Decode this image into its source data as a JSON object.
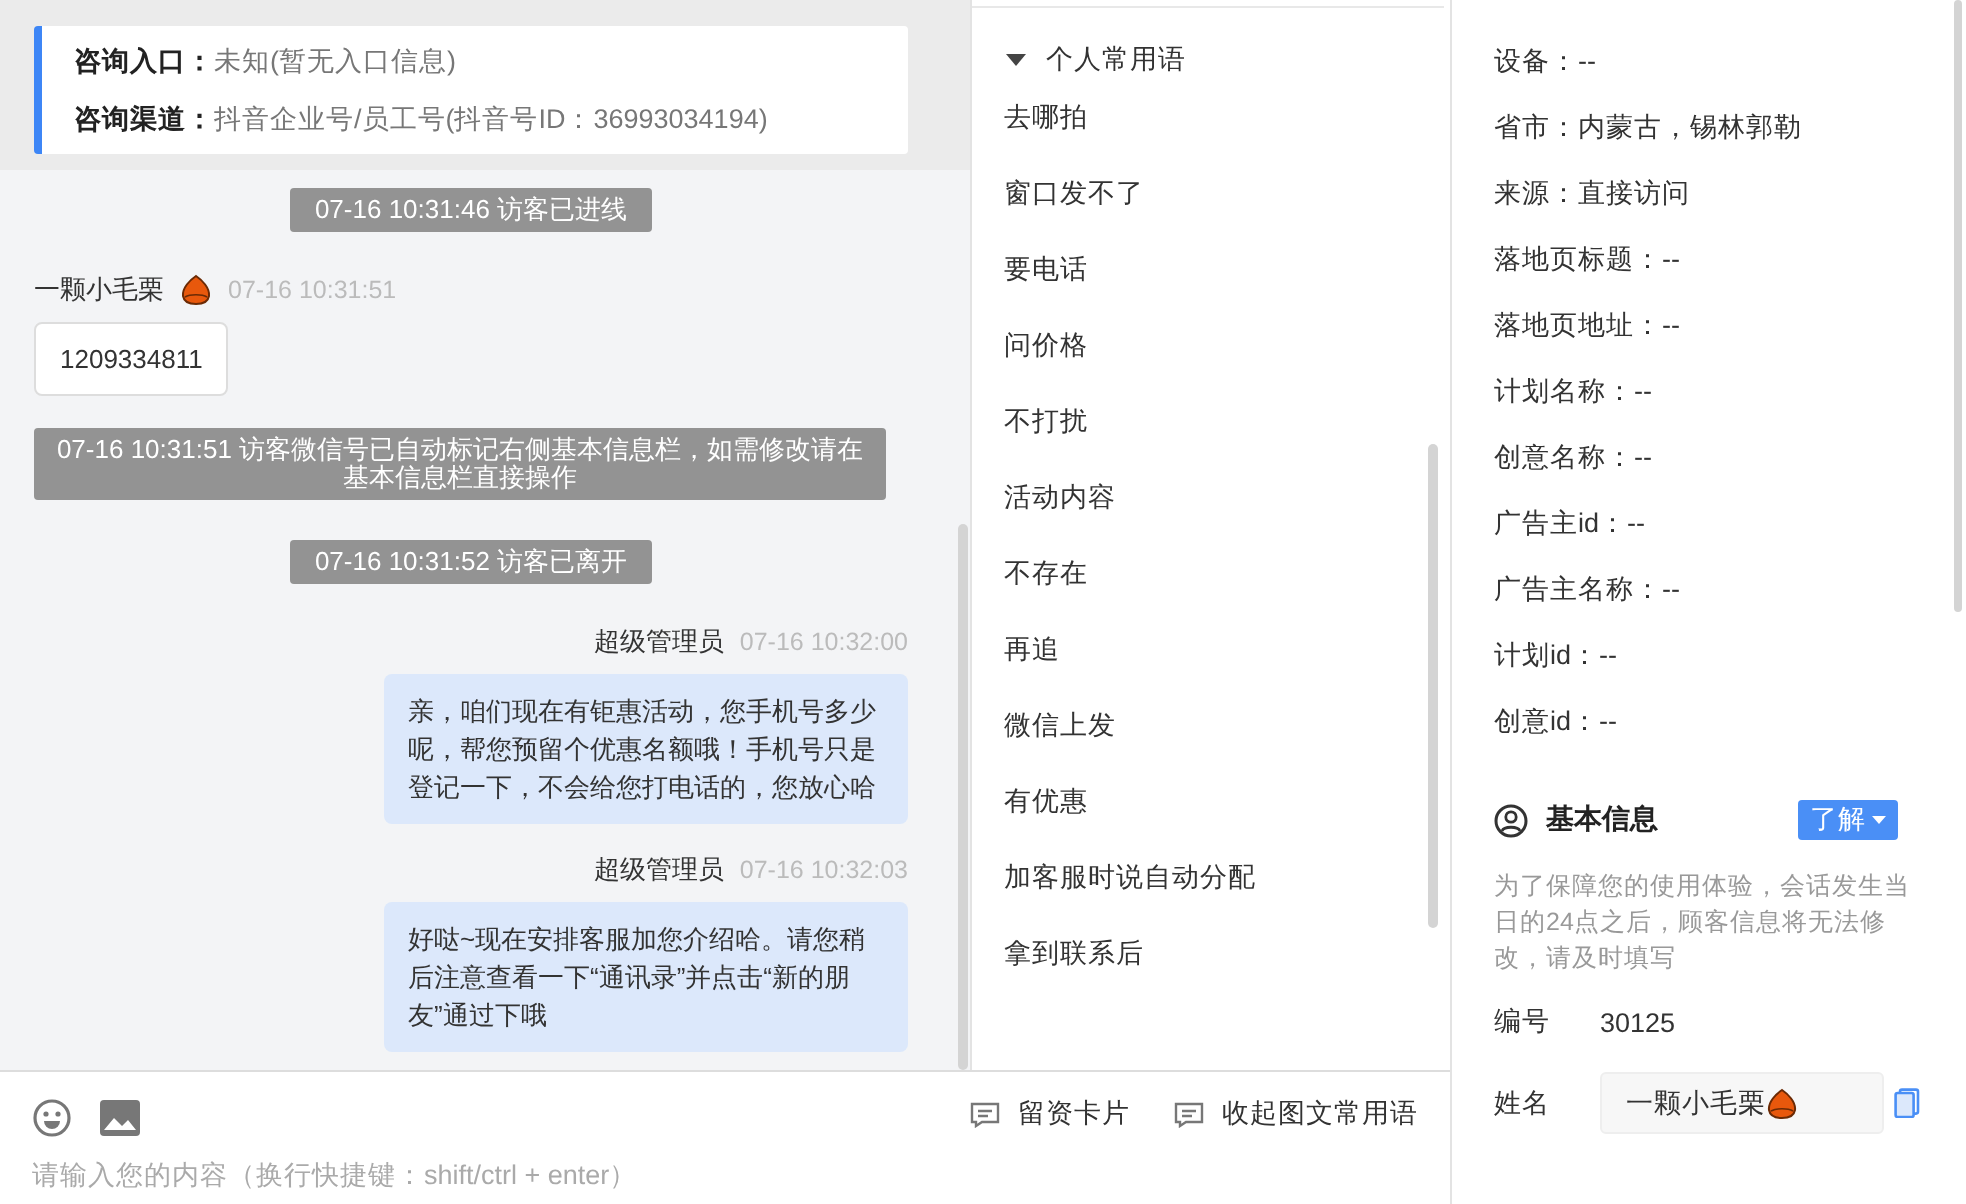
{
  "consult_info": [
    {
      "label": "咨询入口：",
      "value": "未知(暂无入口信息)"
    },
    {
      "label": "咨询渠道：",
      "value": "抖音企业号/员工号(抖音号ID：36993034194)"
    }
  ],
  "messages": [
    {
      "kind": "system",
      "text": "07-16 10:31:46 访客已进线"
    },
    {
      "kind": "visitor",
      "sender": "一颗小毛栗",
      "time": "07-16 10:31:51",
      "text": "1209334811"
    },
    {
      "kind": "system",
      "text": "07-16 10:31:51 访客微信号已自动标记右侧基本信息栏，如需修改请在基本信息栏直接操作"
    },
    {
      "kind": "system",
      "text": "07-16 10:31:52 访客已离开"
    },
    {
      "kind": "agent",
      "sender": "超级管理员",
      "time": "07-16 10:32:00",
      "text": "亲，咱们现在有钜惠活动，您手机号多少呢，帮您预留个优惠名额哦！手机号只是登记一下，不会给您打电话的，您放心哈"
    },
    {
      "kind": "agent",
      "sender": "超级管理员",
      "time": "07-16 10:32:03",
      "text": "好哒~现在安排客服加您介绍哈。请您稍后注意查看一下“通讯录”并点击“新的朋友”通过下哦"
    }
  ],
  "phrases": {
    "title": "个人常用语",
    "expanded": true,
    "items": [
      "去哪拍",
      "窗口发不了",
      "要电话",
      "问价格",
      "不打扰",
      "活动内容",
      "不存在",
      "再追",
      "微信上发",
      "有优惠",
      "加客服时说自动分配",
      "拿到联系后"
    ]
  },
  "composer": {
    "tools": [
      "留资卡片",
      "收起图文常用语"
    ],
    "placeholder": "请输入您的内容（换行快捷键：shift/ctrl + enter）"
  },
  "visit_info": [
    "设备：--",
    "省市：内蒙古，锡林郭勒",
    "来源：直接访问",
    "落地页标题：--",
    "落地页地址：--",
    "计划名称：--",
    "创意名称：--",
    "广告主id：--",
    "广告主名称：--",
    "计划id：--",
    "创意id：--"
  ],
  "basic_info": {
    "title": "基本信息",
    "learn_button": "了解",
    "note": "为了保障您的使用体验，会话发生当日的24点之后，顾客信息将无法修改，请及时填写",
    "fields": [
      {
        "kind": "text",
        "label": "编号",
        "value": "30125"
      },
      {
        "kind": "input",
        "label": "姓名",
        "value": "一颗小毛栗"
      }
    ]
  }
}
